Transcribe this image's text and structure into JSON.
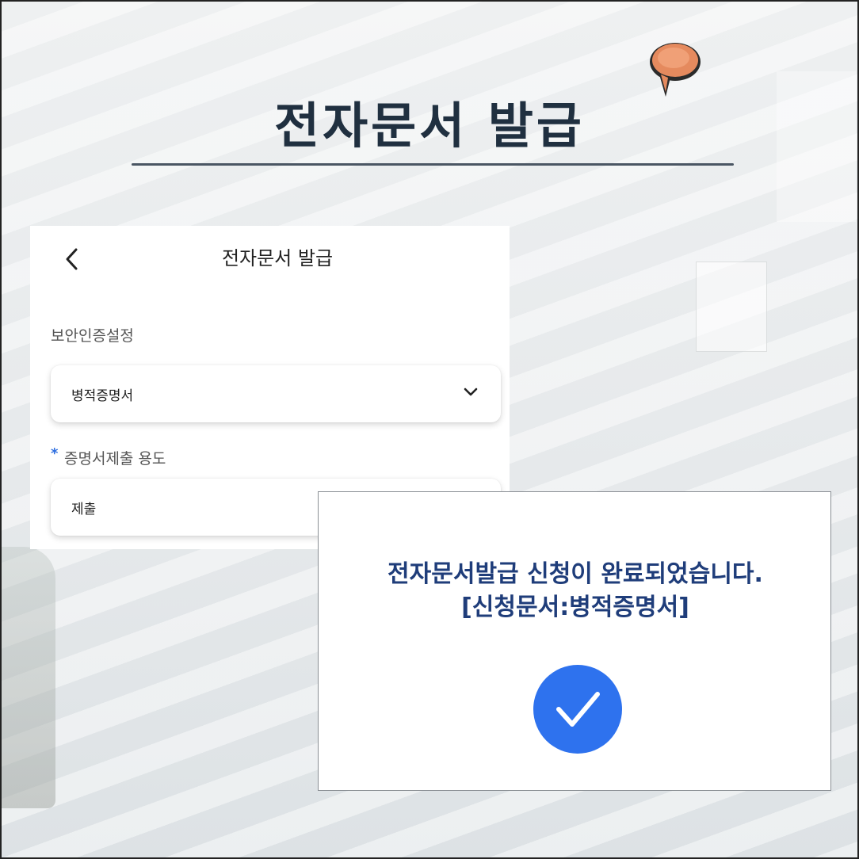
{
  "headline": "전자문서 발급",
  "screen": {
    "title": "전자문서 발급",
    "security_label": "보안인증설정",
    "select_value": "병적증명서",
    "required_mark": "*",
    "purpose_label": "증명서제출 용도",
    "purpose_value": "제출"
  },
  "popup": {
    "line1": "전자문서발급 신청이 완료되었습니다.",
    "line2": "[신청문서:병적증명서]"
  },
  "colors": {
    "headline": "#203040",
    "accent_blue": "#2f6fe0",
    "popup_text": "#1f3d7a",
    "pin": "#e58a5e"
  },
  "icons": {
    "back": "back-arrow-icon",
    "dropdown": "chevron-down-icon",
    "check": "check-circle-icon",
    "pin": "pushpin-icon"
  }
}
